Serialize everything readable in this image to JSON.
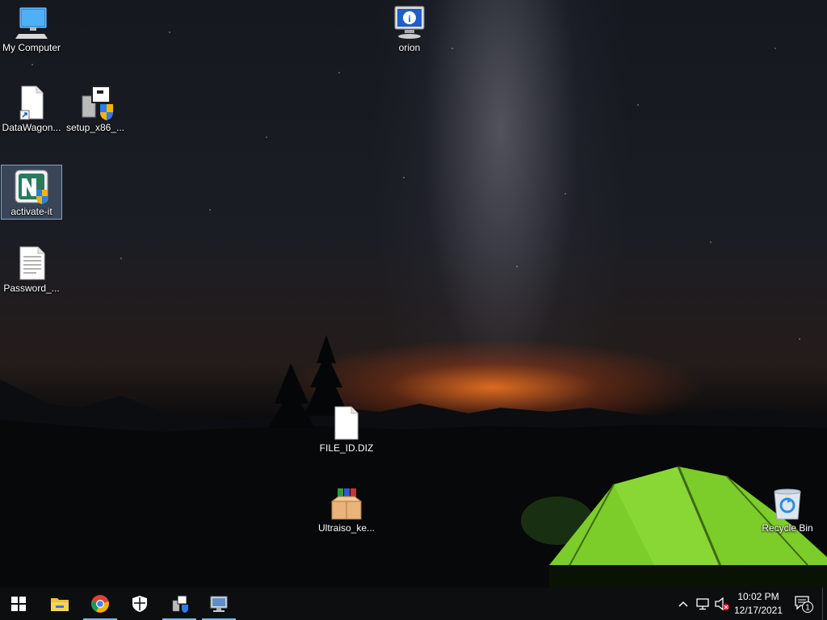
{
  "desktop": {
    "icons": [
      {
        "label": "My Computer",
        "icon": "computer-icon"
      },
      {
        "label": "orion",
        "icon": "info-monitor-icon"
      },
      {
        "label": "DataWagon...",
        "icon": "file-shortcut-icon"
      },
      {
        "label": "setup_x86_...",
        "icon": "installer-icon"
      },
      {
        "label": "activate-it",
        "icon": "activator-app-icon",
        "selected": true
      },
      {
        "label": "Password_...",
        "icon": "text-document-icon"
      },
      {
        "label": "FILE_ID.DIZ",
        "icon": "blank-file-icon"
      },
      {
        "label": "Ultraiso_ke...",
        "icon": "archive-box-icon"
      },
      {
        "label": "Recycle Bin",
        "icon": "recycle-bin-icon"
      }
    ]
  },
  "taskbar": {
    "buttons": [
      {
        "name": "start",
        "icon": "windows-start-icon"
      },
      {
        "name": "file-explorer",
        "icon": "folder-icon"
      },
      {
        "name": "chrome",
        "icon": "chrome-icon",
        "active": true
      },
      {
        "name": "security",
        "icon": "shield-icon"
      },
      {
        "name": "installer",
        "icon": "installer-icon",
        "active": true
      },
      {
        "name": "remote",
        "icon": "monitor-icon",
        "active": true
      }
    ],
    "tray": {
      "chevron": "chevron-up-icon",
      "network": "network-icon",
      "volume": "volume-muted-icon",
      "time": "10:02 PM",
      "date": "12/17/2021",
      "notification_count": "1"
    }
  },
  "colors": {
    "accent": "#76b9ed",
    "taskbar_bg": "#0d0e10",
    "tent_green": "#7ccc2a"
  }
}
